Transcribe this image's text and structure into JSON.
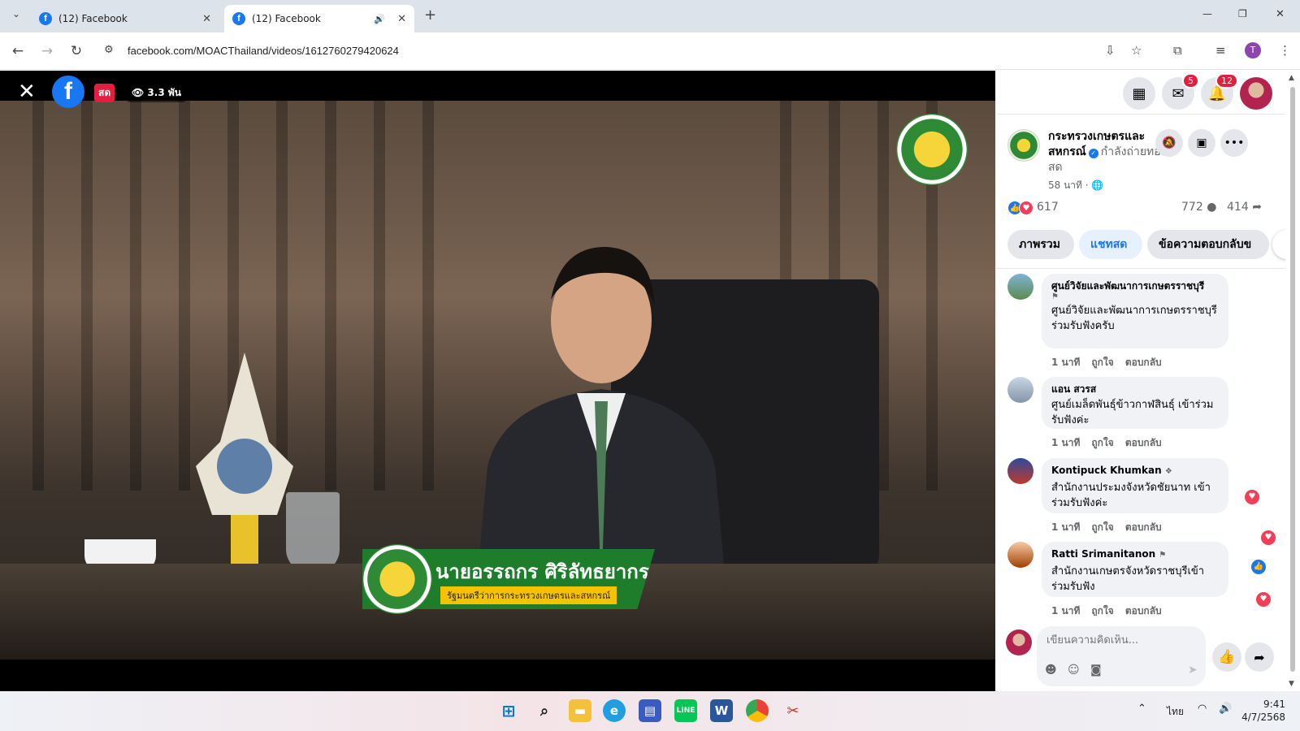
{
  "browser": {
    "tabs": [
      {
        "title": "(12) Facebook",
        "close": "✕"
      },
      {
        "title": "(12) Facebook",
        "close": "✕",
        "audio": "🔊"
      }
    ],
    "new_tab": "+",
    "window_controls": {
      "minimize": "—",
      "maximize": "❐",
      "close": "✕"
    },
    "url": "facebook.com/MOACThailand/videos/1612760279420624",
    "profile_initial": "T"
  },
  "video": {
    "close": "✕",
    "fb_logo": "f",
    "live_badge": "สด",
    "views": "3.3 พัน",
    "lower_third_name": "นายอรรถกร ศิริลัทธยากร",
    "lower_third_title": "รัฐมนตรีว่าการกระทรวงเกษตรและสหกรณ์"
  },
  "topbar": {
    "messenger_badge": "5",
    "notifications_badge": "12"
  },
  "post": {
    "page_name": "กระทรวงเกษตรและสหกรณ์",
    "live_status": "กำลังถ่ายทอดสด",
    "time": "58 นาที ·",
    "reactions_count": "617",
    "comments_count": "772",
    "shares_count": "414"
  },
  "panel_tabs": [
    "ภาพรวม",
    "แชทสด",
    "ข้อความตอบกลับข"
  ],
  "comments": [
    {
      "author": "ศูนย์วิจัยและพัฒนาการเกษตรราชบุรี",
      "body": "ศูนย์วิจัยและพัฒนาการเกษตรราชบุรี ร่วมรับฟังครับ",
      "time": "1 นาที",
      "like": "ถูกใจ",
      "reply": "ตอบกลับ"
    },
    {
      "author": "แอน สวรส",
      "body": "ศูนย์เมล็ดพันธุ์ข้าวกาฬสินธุ์ เข้าร่วมรับฟังค่ะ",
      "time": "1 นาที",
      "like": "ถูกใจ",
      "reply": "ตอบกลับ"
    },
    {
      "author": "Kontipuck Khumkan",
      "body": "สำนักงานประมงจังหวัดชัยนาท เข้าร่วมรับฟังค่ะ",
      "time": "1 นาที",
      "like": "ถูกใจ",
      "reply": "ตอบกลับ"
    },
    {
      "author": "Ratti Srimanitanon",
      "body": "สำนักงานเกษตรจังหวัดราชบุรีเข้าร่วมรับฟัง",
      "time": "1 นาที",
      "like": "ถูกใจ",
      "reply": "ตอบกลับ"
    }
  ],
  "composer": {
    "placeholder": "เขียนความคิดเห็น..."
  },
  "taskbar": {
    "language": "ไทย",
    "time": "9:41",
    "date": "4/7/2568"
  },
  "colors": {
    "facebook_blue": "#1877f2",
    "live_red": "#e41e3f",
    "heart": "#f33e58",
    "ministry_green": "#1e7d2a"
  }
}
